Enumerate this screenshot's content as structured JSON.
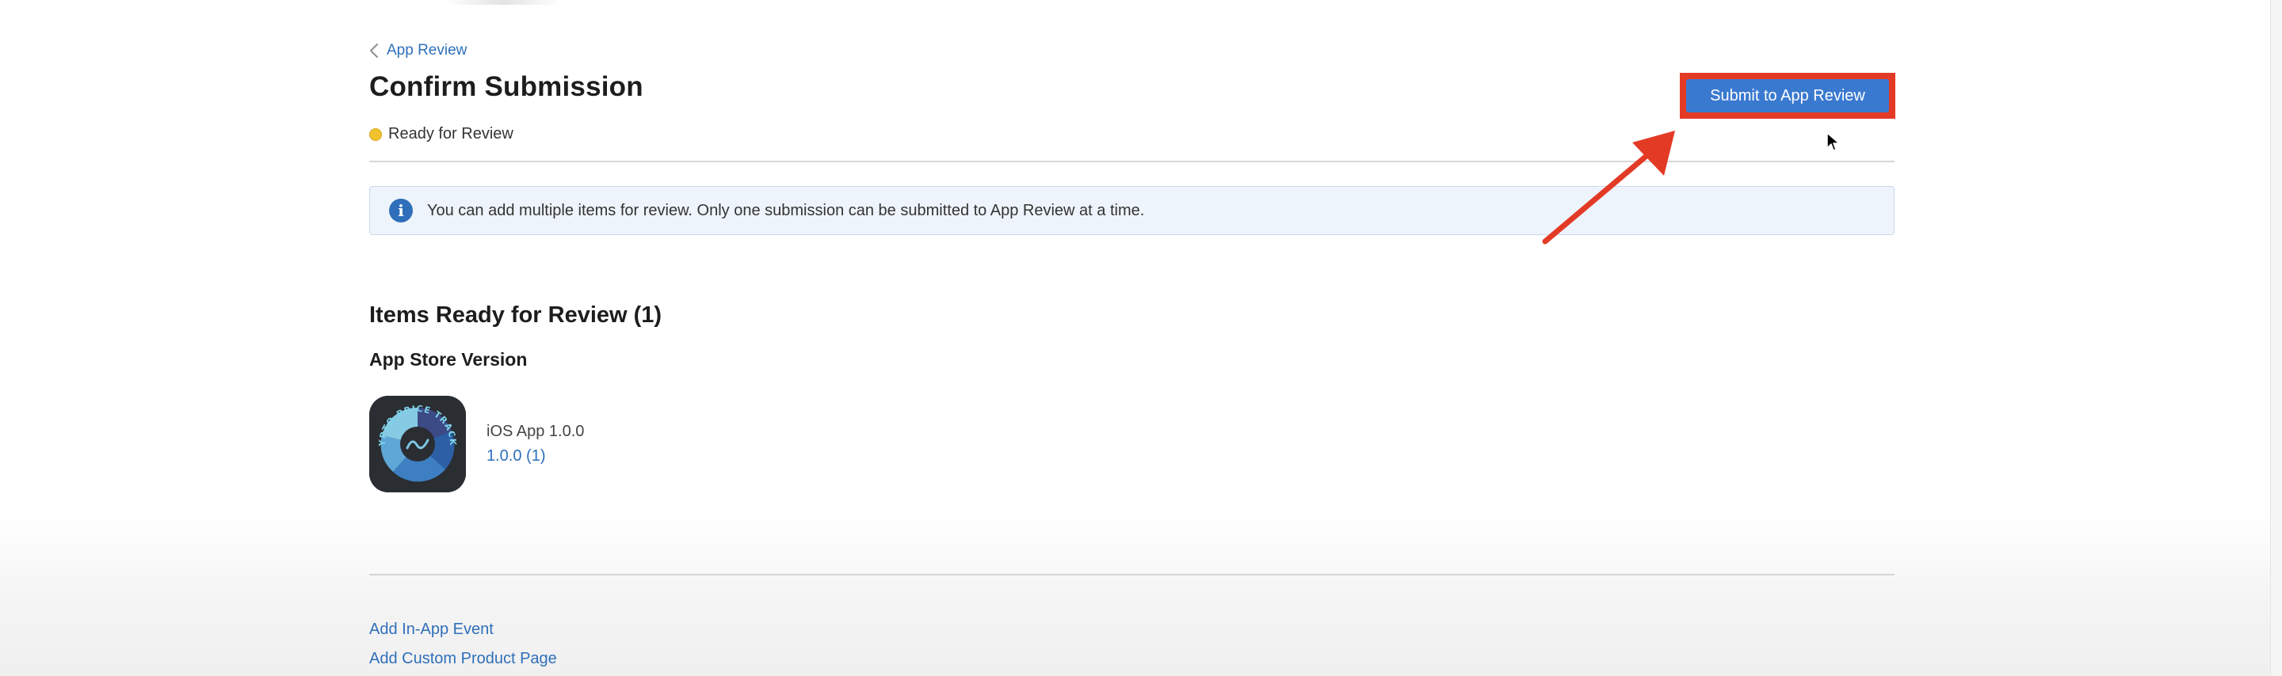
{
  "breadcrumb": {
    "back_label": "App Review"
  },
  "header": {
    "title": "Confirm Submission",
    "status": "Ready for Review",
    "status_color": "#f0c22e",
    "submit_label": "Submit to App Review",
    "accent_color": "#3a79d0",
    "highlight_color": "#e33a26"
  },
  "banner": {
    "message": "You can add multiple items for review. Only one submission can be submitted to App Review at a time.",
    "icon": "info-icon"
  },
  "items": {
    "section_title": "Items Ready for Review (1)",
    "group_title": "App Store Version",
    "list": [
      {
        "icon_text": "CRYPTO PRICE TRACKER",
        "name": "iOS App 1.0.0",
        "version": "1.0.0 (1)"
      }
    ]
  },
  "footer": {
    "links": [
      "Add In-App Event",
      "Add Custom Product Page"
    ]
  }
}
